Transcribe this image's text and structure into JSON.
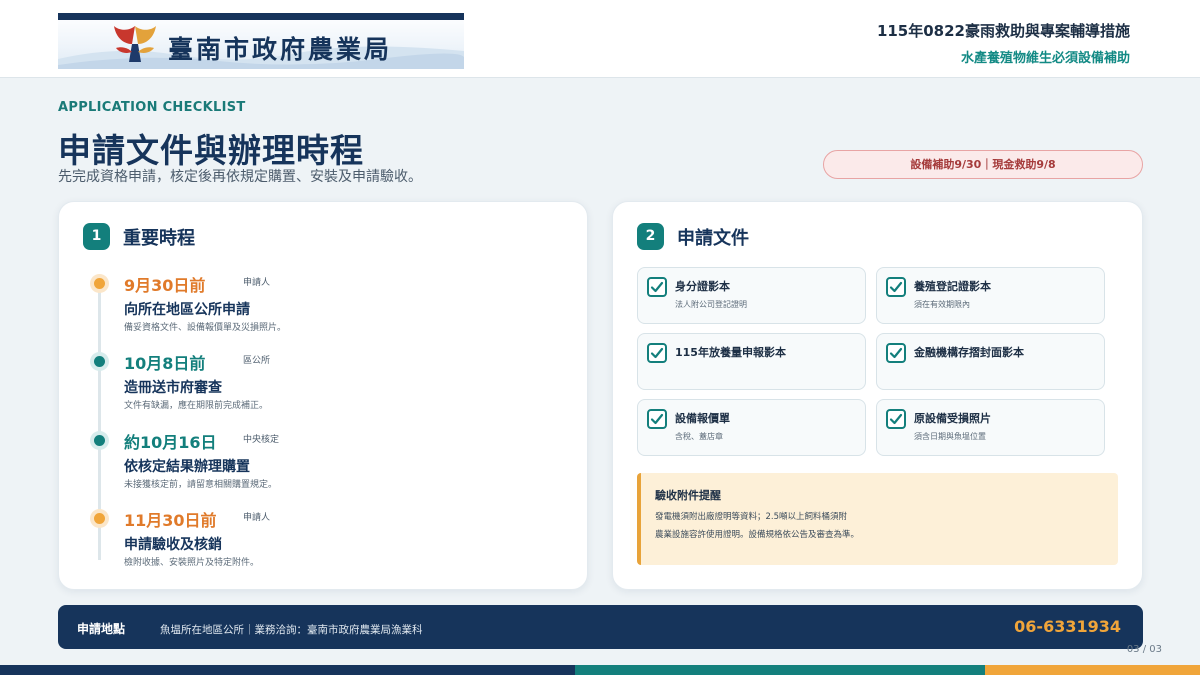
{
  "header": {
    "logo_text": "臺南市政府農業局",
    "title": "115年0822豪雨救助與專案輔導措施",
    "subtitle": "水產養殖物維生必須設備補助"
  },
  "hero": {
    "eyebrow": "APPLICATION CHECKLIST",
    "title": "申請文件與辦理時程",
    "description": "先完成資格申請，核定後再依規定購置、安裝及申請驗收。",
    "deadline_pill": "設備補助9/30｜現金救助9/8"
  },
  "timeline_card": {
    "badge": "1",
    "title": "重要時程",
    "items": [
      {
        "date": "9月30日前",
        "role": "申請人",
        "action": "向所在地區公所申請",
        "note": "備妥資格文件、設備報價單及災損照片。",
        "color": "orange"
      },
      {
        "date": "10月8日前",
        "role": "區公所",
        "action": "造冊送市府審查",
        "note": "文件有缺漏，應在期限前完成補正。",
        "color": "teal"
      },
      {
        "date": "約10月16日",
        "role": "中央核定",
        "action": "依核定結果辦理購置",
        "note": "未接獲核定前，請留意相關購置規定。",
        "color": "teal"
      },
      {
        "date": "11月30日前",
        "role": "申請人",
        "action": "申請驗收及核銷",
        "note": "檢附收據、安裝照片及特定附件。",
        "color": "orange"
      }
    ]
  },
  "documents_card": {
    "badge": "2",
    "title": "申請文件",
    "docs": [
      {
        "name": "身分證影本",
        "note": "法人附公司登記證明"
      },
      {
        "name": "養殖登記證影本",
        "note": "須在有效期限內"
      },
      {
        "name": "115年放養量申報影本",
        "note": ""
      },
      {
        "name": "金融機構存摺封面影本",
        "note": ""
      },
      {
        "name": "設備報價單",
        "note": "含稅、蓋店章"
      },
      {
        "name": "原設備受損照片",
        "note": "須含日期與魚塭位置"
      }
    ],
    "notice": {
      "title": "驗收附件提醒",
      "line1": "發電機須附出廠證明等資料；2.5噸以上飼料桶須附",
      "line2": "農業設施容許使用證明。設備規格依公告及審查為準。"
    }
  },
  "footer": {
    "label": "申請地點",
    "text": "魚塭所在地區公所｜業務洽詢：臺南市政府農業局漁業科",
    "phone": "06-6331934",
    "page": "03 / 03"
  },
  "colors": {
    "navy": "#16345b",
    "teal": "#137f7c",
    "orange": "#e07a2a",
    "amber": "#f0a53a",
    "alert_red": "#a53b3b"
  }
}
